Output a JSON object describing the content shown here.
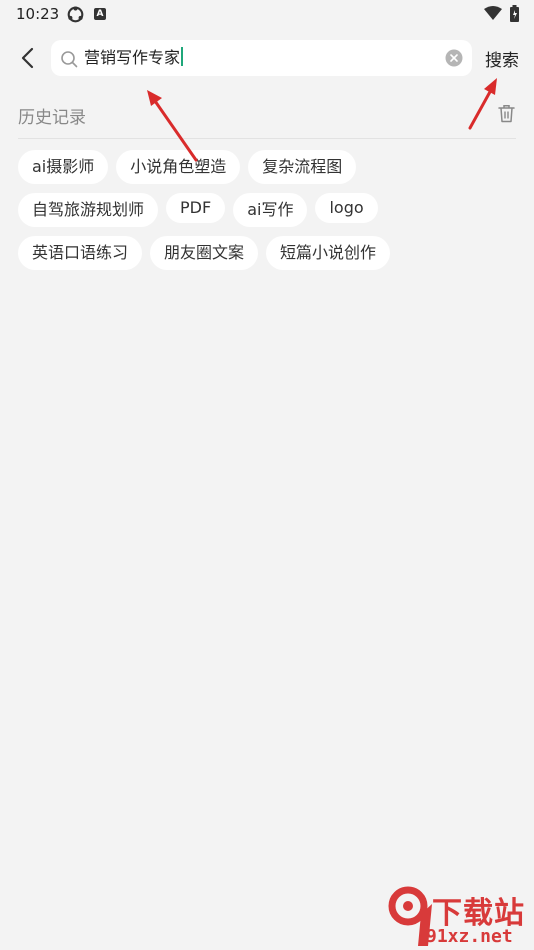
{
  "status_bar": {
    "time": "10:23",
    "icons": [
      "sync-icon",
      "a-notification-icon",
      "wifi-icon",
      "battery-icon"
    ]
  },
  "search": {
    "back_icon": "chevron-left-icon",
    "search_icon": "search-icon",
    "value": "营销写作专家",
    "clear_icon": "clear-circle-icon",
    "button_label": "搜索"
  },
  "history": {
    "title": "历史记录",
    "delete_icon": "trash-icon",
    "rows": [
      [
        "ai摄影师",
        "小说角色塑造",
        "复杂流程图"
      ],
      [
        "自驾旅游规划师",
        "PDF",
        "ai写作",
        "logo"
      ],
      [
        "英语口语练习",
        "朋友圈文案",
        "短篇小说创作"
      ]
    ]
  },
  "annotations": {
    "arrow_color": "#d92b2b"
  },
  "watermark": {
    "logo_text": "下载站",
    "url_text": "91xz.net"
  },
  "colors": {
    "background": "#f3f3f3",
    "caret": "#1fa77a",
    "tag_bg": "#ffffff",
    "muted_text": "#888888"
  }
}
